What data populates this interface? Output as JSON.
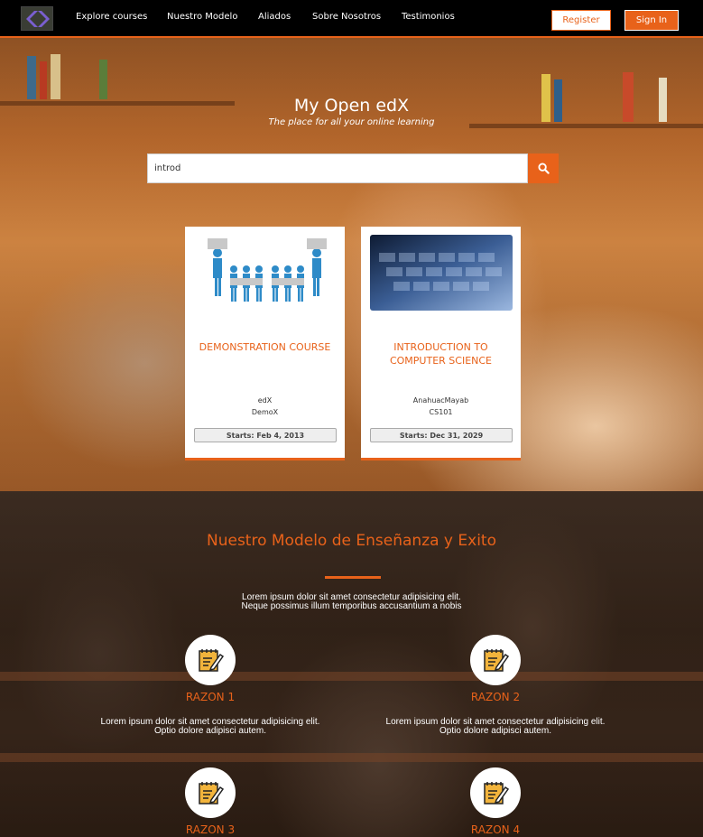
{
  "nav": {
    "logo_alt": "logo",
    "links": [
      "Explore courses",
      "Nuestro Modelo",
      "Aliados",
      "Sobre Nosotros",
      "Testimonios"
    ],
    "register_label": "Register",
    "signin_label": "Sign In"
  },
  "hero": {
    "title": "My Open edX",
    "subtitle": "The place for all your online learning",
    "search_value": "introd",
    "search_icon": "search-icon"
  },
  "courses": [
    {
      "title": "DEMONSTRATION COURSE",
      "org": "edX",
      "code": "DemoX",
      "start": "Starts: Feb 4, 2013",
      "image": "puzzle-people-image"
    },
    {
      "title": "INTRODUCTION TO COMPUTER SCIENCE",
      "org": "AnahuacMayab",
      "code": "CS101",
      "start": "Starts: Dec 31, 2029",
      "image": "keyboard-image"
    }
  ],
  "model": {
    "title": "Nuestro Modelo de Enseñanza y Exito",
    "lead_line1": "Lorem ipsum dolor sit amet consectetur adipisicing elit.",
    "lead_line2": "Neque possimus illum temporibus accusantium a nobis",
    "reasons": [
      {
        "title": "RAZON 1",
        "text1": "Lorem ipsum dolor sit amet consectetur adipisicing elit.",
        "text2": "Optio dolore adipisci autem."
      },
      {
        "title": "RAZON 2",
        "text1": "Lorem ipsum dolor sit amet consectetur adipisicing elit.",
        "text2": "Optio dolore adipisci autem."
      },
      {
        "title": "RAZON 3"
      },
      {
        "title": "RAZON 4"
      }
    ]
  },
  "colors": {
    "accent": "#e8621a",
    "nav_bg": "#000000"
  }
}
